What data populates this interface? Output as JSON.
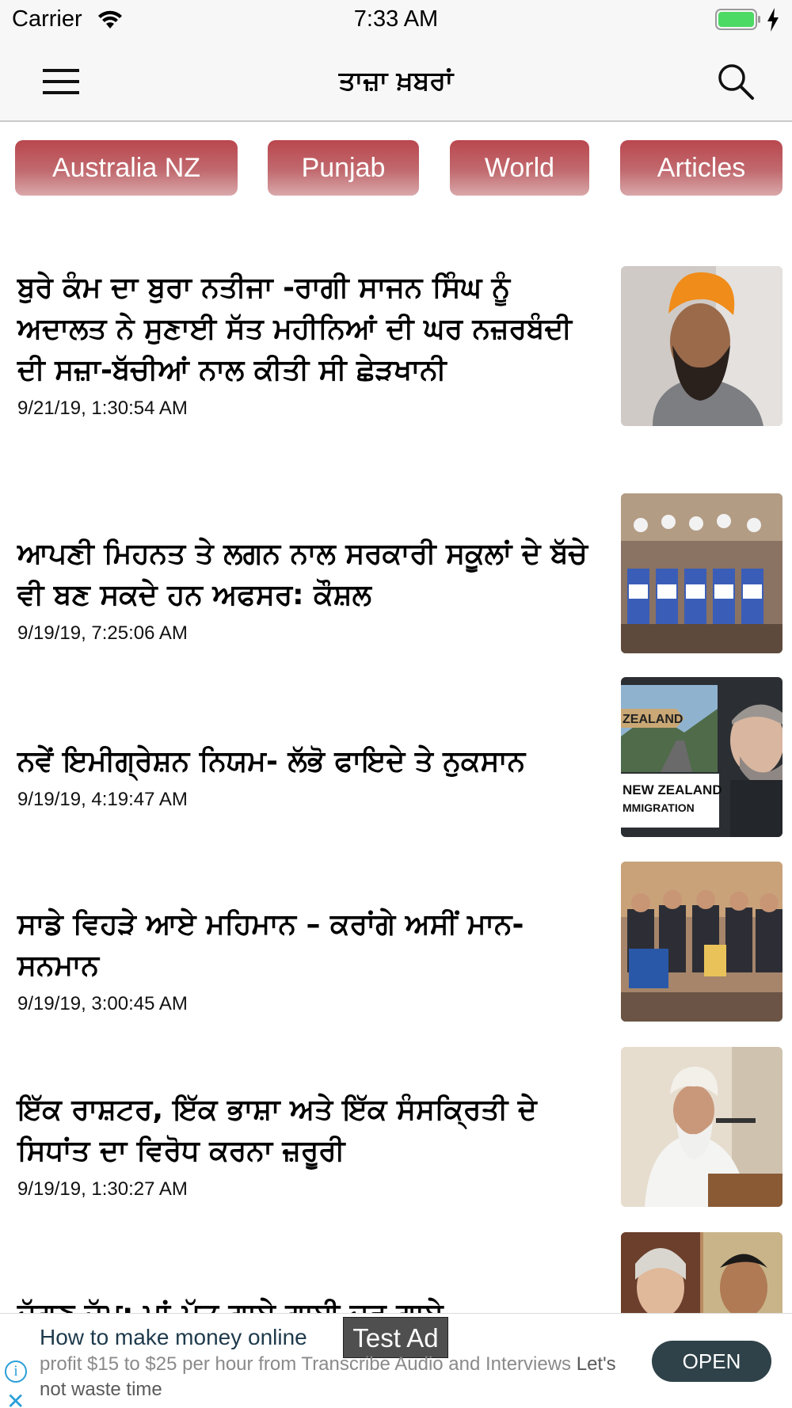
{
  "status_bar": {
    "carrier": "Carrier",
    "time": "7:33 AM",
    "wifi_icon": "wifi-icon",
    "battery_icon": "battery-charging-icon"
  },
  "nav": {
    "title": "ਤਾਜ਼ਾ ਖ਼ਬਰਾਂ",
    "menu_icon": "hamburger-menu-icon",
    "search_icon": "search-icon"
  },
  "tabs": [
    {
      "label": "Australia NZ"
    },
    {
      "label": "Punjab"
    },
    {
      "label": "World"
    },
    {
      "label": "Articles"
    }
  ],
  "news": [
    {
      "title": "ਬੁਰੇ ਕੰਮ ਦਾ ਬੁਰਾ ਨਤੀਜਾ -ਰਾਗੀ ਸਾਜਨ ਸਿੰਘ ਨੂੰ ਅਦਾਲਤ ਨੇ ਸੁਣਾਈ ਸੱਤ ਮਹੀਨਿਆਂ ਦੀ ਘਰ ਨਜ਼ਰਬੰਦੀ ਦੀ ਸਜ਼ਾ-ਬੱਚੀਆਂ ਨਾਲ ਕੀਤੀ ਸੀ ਛੇੜਖਾਨੀ",
      "date": "9/21/19, 1:30:54 AM"
    },
    {
      "title": "ਆਪਣੀ ਮਿਹਨਤ ਤੇ ਲਗਨ ਨਾਲ ਸਰਕਾਰੀ ਸਕੂਲਾਂ ਦੇ ਬੱਚੇ ਵੀ ਬਣ ਸਕਦੇ ਹਨ ਅਫਸਰ: ਕੌਸ਼ਲ",
      "date": "9/19/19, 7:25:06 AM"
    },
    {
      "title": "ਨਵੇਂ ਇਮੀਗ੍ਰੇਸ਼ਨ ਨਿਯਮ- ਲੱਭੋ ਫਾਇਦੇ ਤੇ ਨੁਕਸਾਨ",
      "date": "9/19/19, 4:19:47 AM",
      "thumb_text": [
        "ZEALAND",
        "NEW ZEALAND",
        "MMIGRATION"
      ]
    },
    {
      "title": "ਸਾਡੇ ਵਿਹੜੇ ਆਏ ਮਹਿਮਾਨ – ਕਰਾਂਗੇ ਅਸੀਂ ਮਾਨ-ਸਨਮਾਨ",
      "date": "9/19/19, 3:00:45 AM"
    },
    {
      "title": "ਇੱਕ ਰਾਸ਼ਟਰ, ਇੱਕ ਭਾਸ਼ਾ ਅਤੇ ਇੱਕ ਸੰਸਕ੍ਰਿਤੀ ਦੇ ਸਿਧਾਂਤ ਦਾ ਵਿਰੋਧ ਕਰਨਾ ਜ਼ਰੂਰੀ",
      "date": "9/19/19, 1:30:27 AM"
    },
    {
      "title": "ਦੁੱਗਣ ਜੁੱਮ: ਮਾਂ-ਪੁੱਤ ਗਾਏ ਗਾਈ ਦਰ ਗਾਏ",
      "date": ""
    }
  ],
  "ad": {
    "headline": "How to make money online",
    "label": "Test Ad",
    "body": "profit $15 to $25 per hour from Transcribe Audio and Interviews",
    "body_emph": "Let's not waste time",
    "cta": "OPEN",
    "info_icon": "info-icon",
    "close_icon": "close-icon"
  }
}
